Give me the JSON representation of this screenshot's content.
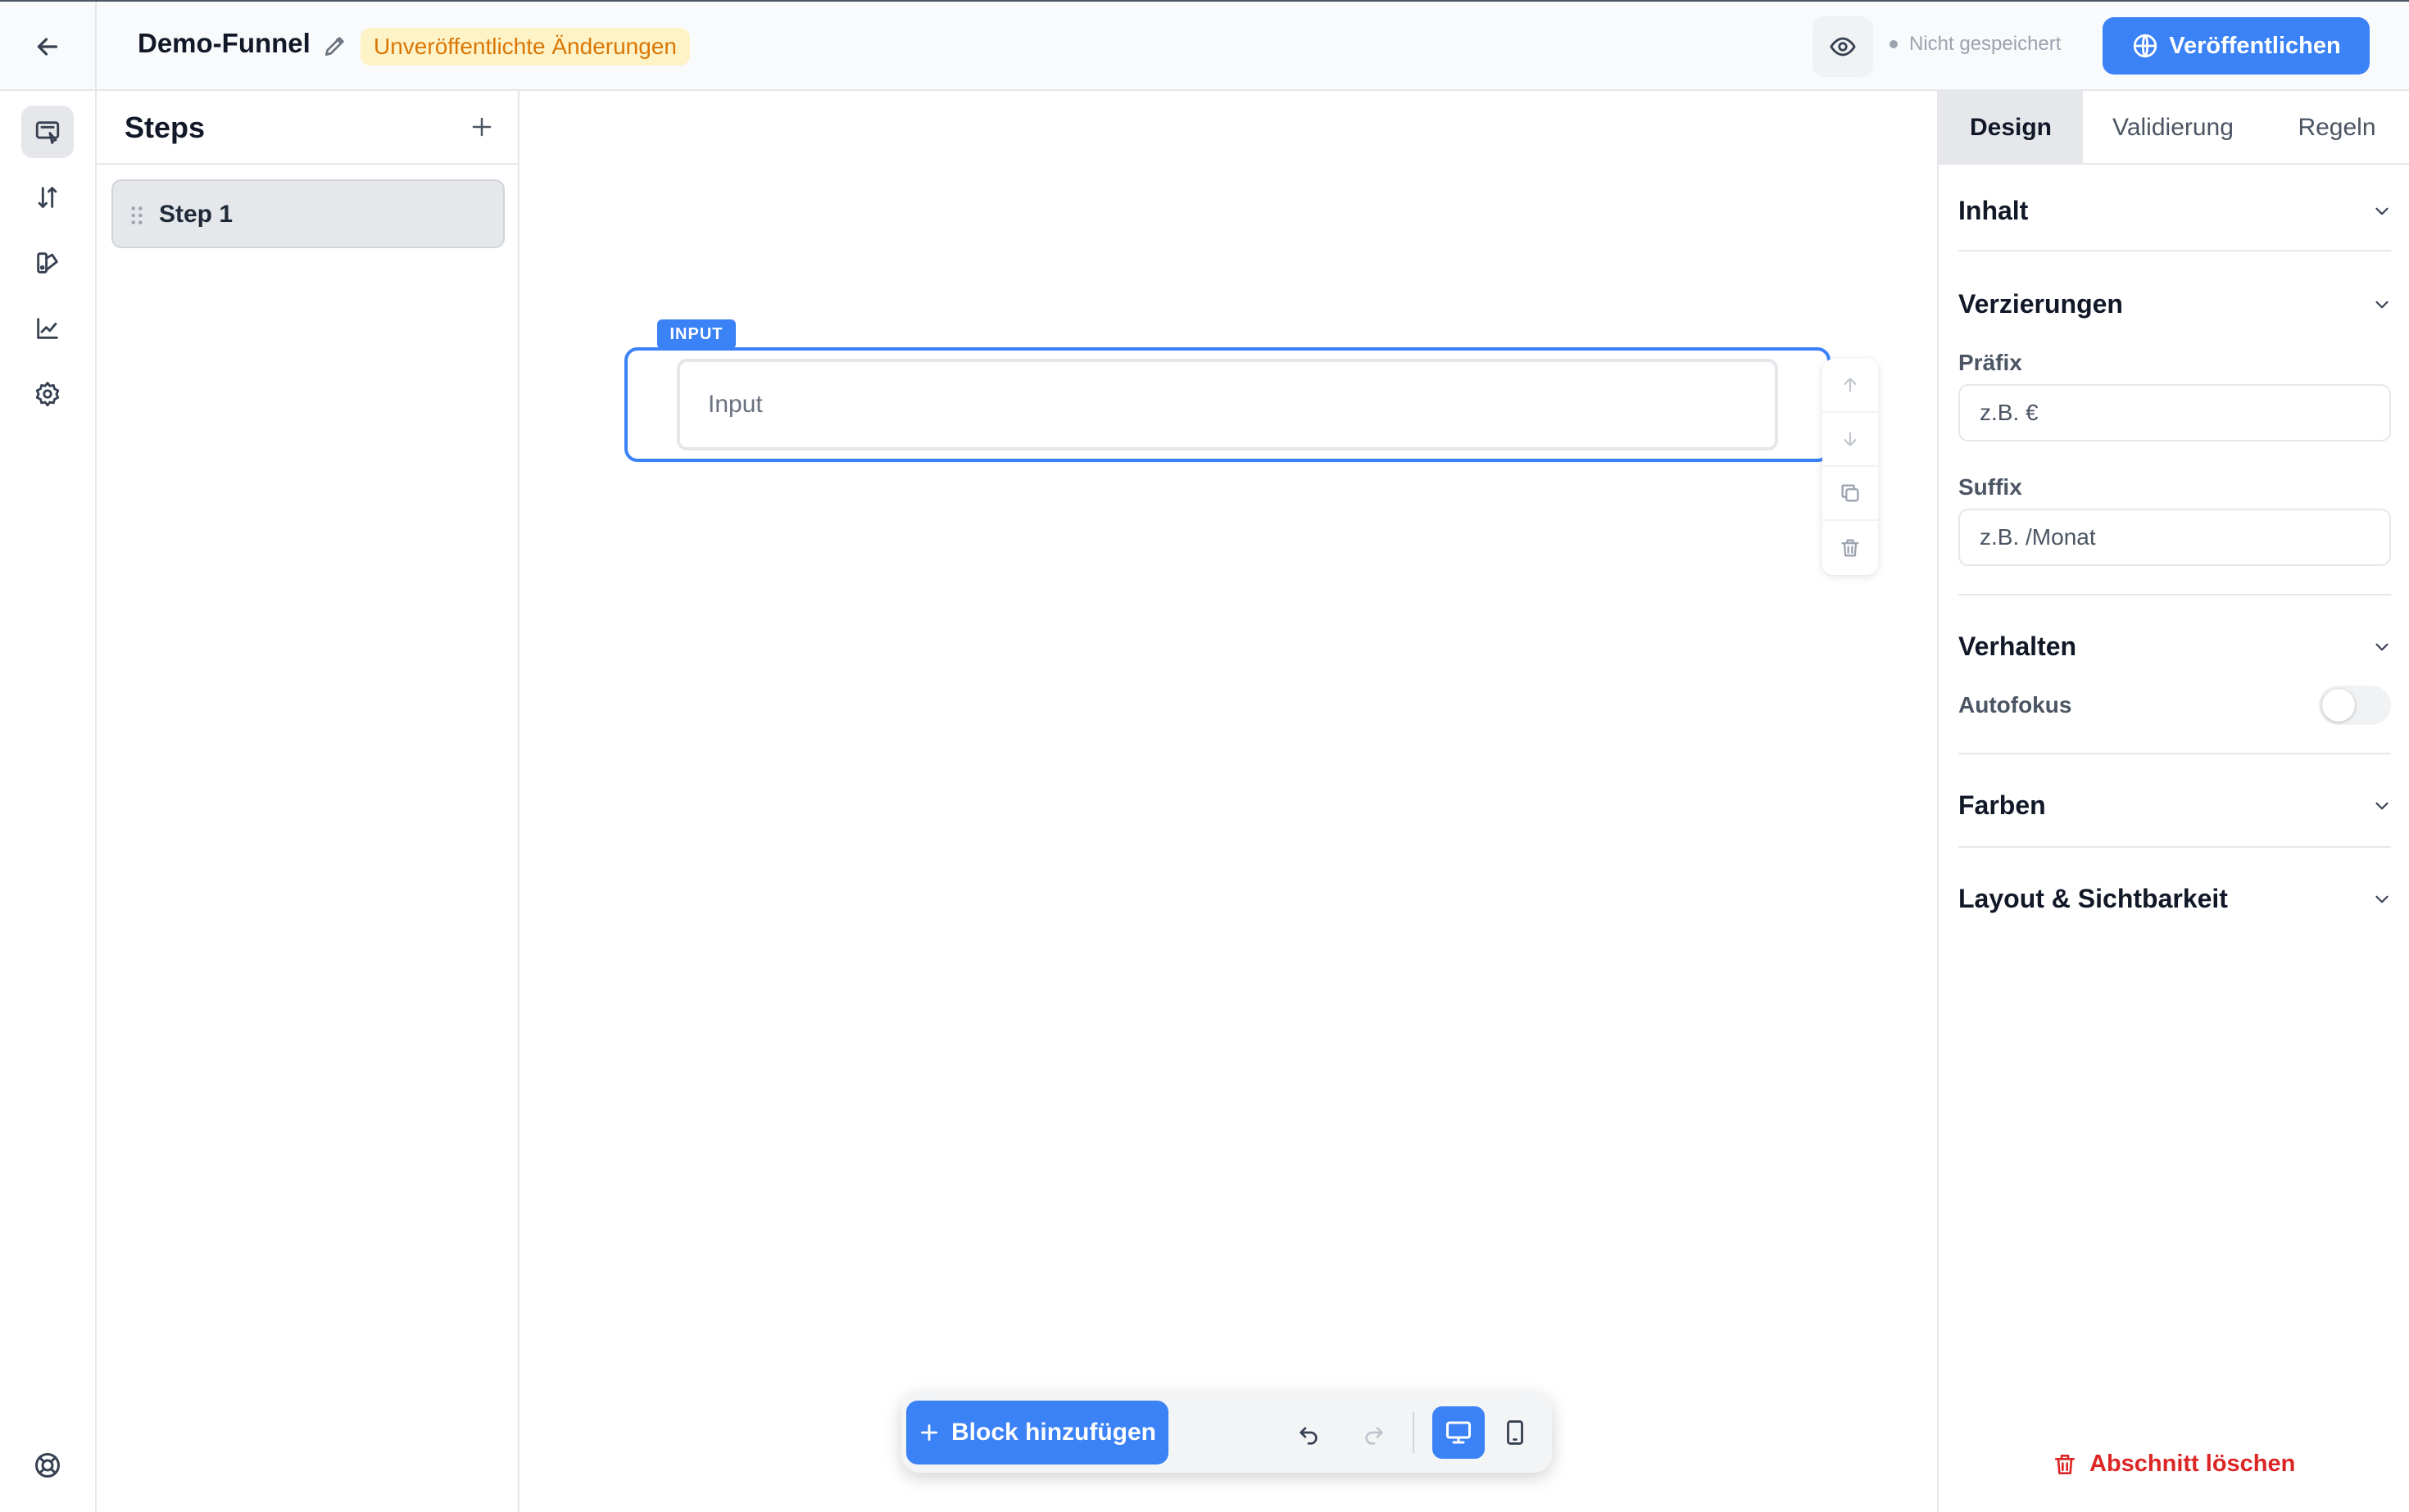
{
  "header": {
    "funnel_title": "Demo-Funnel",
    "unpublished_badge": "Unveröffentlichte Änderungen",
    "save_status": "Nicht gespeichert",
    "publish_label": "Veröffentlichen",
    "colors": {
      "accent": "#3b82f6",
      "badge_bg": "#fef3c7",
      "badge_text": "#d97706"
    }
  },
  "rail": {
    "items": [
      {
        "icon": "canvas-editor-icon",
        "active": true
      },
      {
        "icon": "sort-arrows-icon",
        "active": false
      },
      {
        "icon": "theme-icon",
        "active": false
      },
      {
        "icon": "analytics-chart-icon",
        "active": false
      },
      {
        "icon": "gear-icon",
        "active": false
      }
    ],
    "bottom_icon": "help-lifebuoy-icon"
  },
  "steps": {
    "title": "Steps",
    "items": [
      {
        "label": "Step 1"
      }
    ]
  },
  "canvas": {
    "block_tag": "INPUT",
    "input_placeholder": "Input",
    "block_tools": [
      "move-up-icon",
      "move-down-icon",
      "duplicate-icon",
      "trash-icon"
    ]
  },
  "bottom_bar": {
    "add_block_label": "Block hinzufügen",
    "active_device": "desktop"
  },
  "right_panel": {
    "tabs": [
      {
        "label": "Design",
        "active": true
      },
      {
        "label": "Validierung",
        "active": false
      },
      {
        "label": "Regeln",
        "active": false
      }
    ],
    "sections": {
      "inhalt": "Inhalt",
      "verzierungen": "Verzierungen",
      "verhalten": "Verhalten",
      "farben": "Farben",
      "layout": "Layout & Sichtbarkeit"
    },
    "prefix_label": "Präfix",
    "prefix_placeholder": "z.B. €",
    "suffix_label": "Suffix",
    "suffix_placeholder": "z.B. /Monat",
    "autofocus_label": "Autofokus",
    "autofocus_on": false,
    "delete_section_label": "Abschnitt löschen",
    "delete_color": "#dc2626"
  }
}
